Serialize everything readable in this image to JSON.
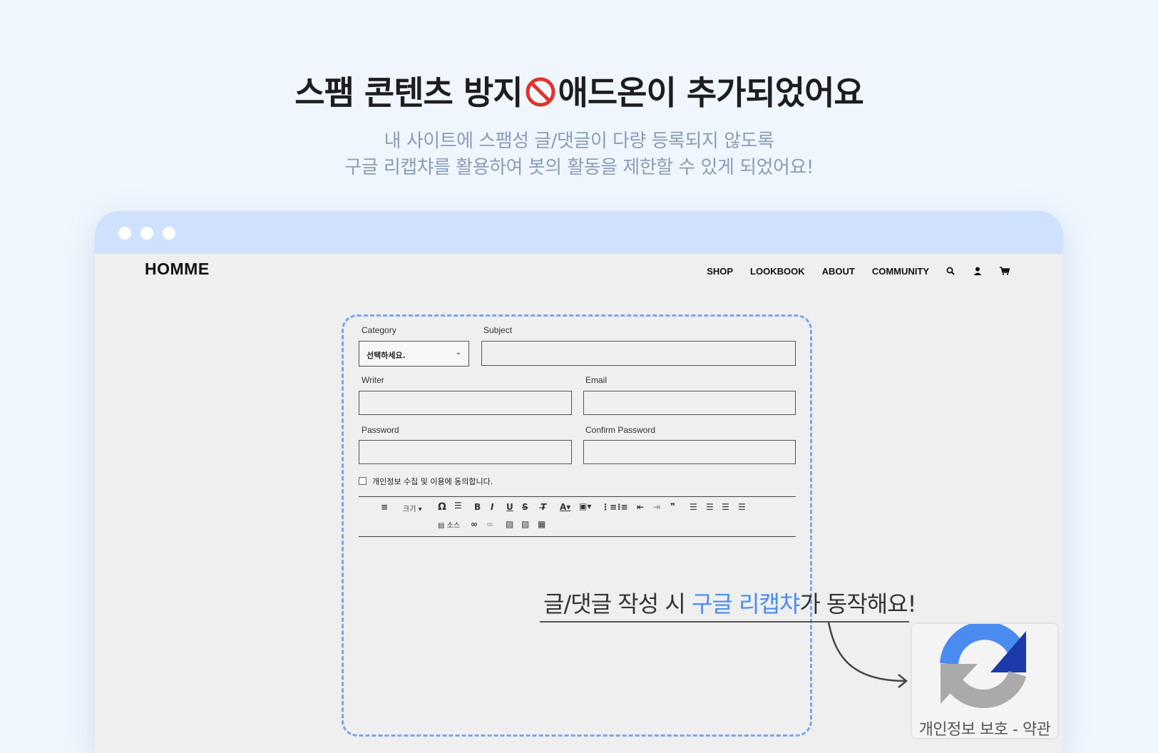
{
  "hero": {
    "title_before": "스팸 콘텐츠 방지",
    "title_after": "애드온이 추가되었어요",
    "subtitle_line1": "내 사이트에 스팸성 글/댓글이 다량 등록되지 않도록",
    "subtitle_line2": "구글 리캡챠를 활용하여 봇의 활동을 제한할 수 있게 되었어요!"
  },
  "site": {
    "logo": "HOMME",
    "menu": [
      "SHOP",
      "LOOKBOOK",
      "ABOUT",
      "COMMUNITY"
    ],
    "icons": [
      "search-icon",
      "user-icon",
      "cart-icon"
    ]
  },
  "form": {
    "category_label": "Category",
    "category_value": "선택하세요.",
    "subject_label": "Subject",
    "writer_label": "Writer",
    "email_label": "Email",
    "password_label": "Password",
    "confirm_password_label": "Confirm Password",
    "agree_text": "개인정보 수집 및 이용에 동의합니다.",
    "toolbar": {
      "font_size_label": "크기",
      "source_label": "소스",
      "bold": "B",
      "italic": "I",
      "underline": "U",
      "strike": "S",
      "special_char": "Ω",
      "quote": "❞"
    }
  },
  "annotation": {
    "text_before": "글/댓글 작성 시 ",
    "text_accent": "구글 리캡챠",
    "text_after": "가 동작해요!"
  },
  "recaptcha": {
    "privacy": "개인정보 보호",
    "separator": " - ",
    "terms": "약관"
  },
  "colors": {
    "accent": "#4a8bf0",
    "titlebar": "#cfe1fc",
    "dashed_border": "#7aa6ee",
    "subtitle": "#8a9cb6"
  }
}
